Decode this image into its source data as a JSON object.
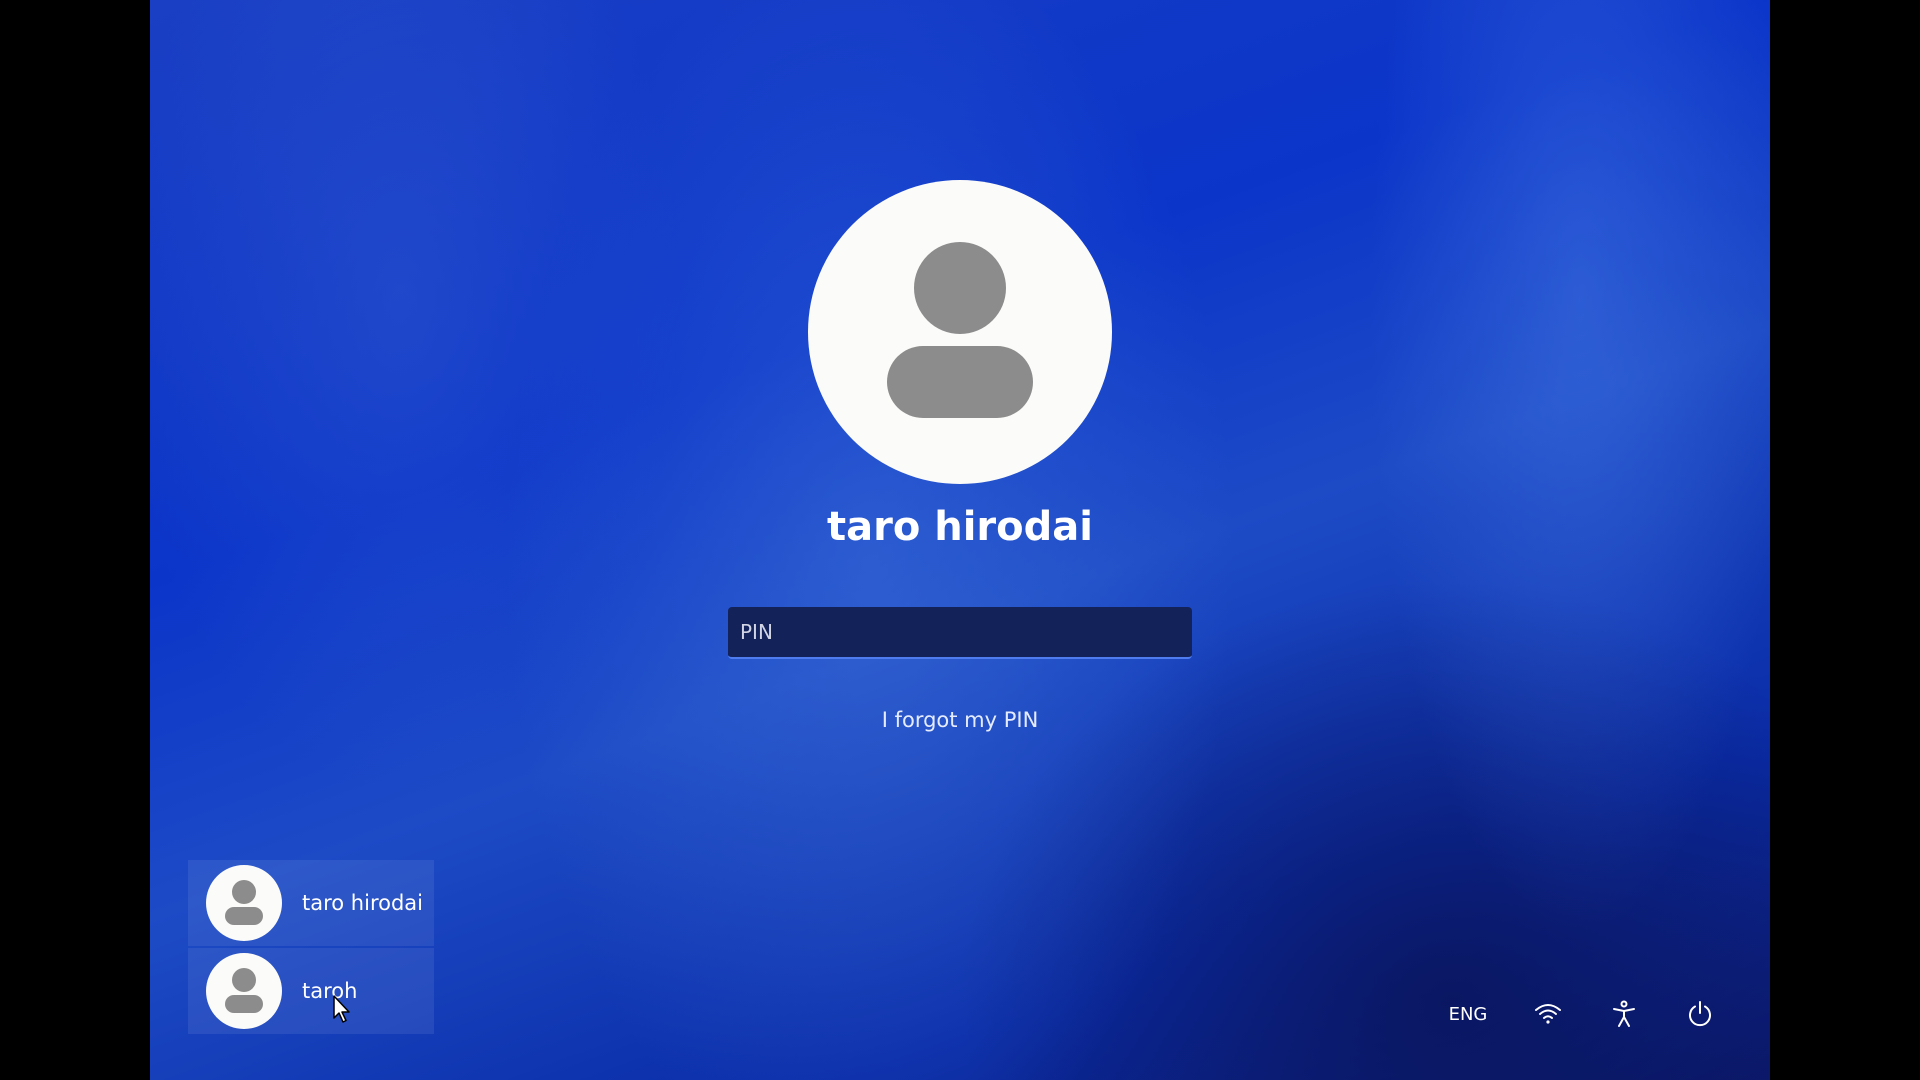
{
  "lock_screen": {
    "current_user": "taro hirodai",
    "pin_field": {
      "placeholder": "PIN",
      "value": ""
    },
    "forgot_pin_label": "I forgot my PIN"
  },
  "user_list": [
    {
      "name": "taro hirodai"
    },
    {
      "name": "taroh"
    }
  ],
  "system_tray": {
    "language": "ENG",
    "icons": [
      "wifi-icon",
      "accessibility-icon",
      "power-icon"
    ]
  },
  "colors": {
    "background_blue": "#0b35c9",
    "avatar_fill": "#fbfbf9",
    "avatar_silhouette": "#8c8c8c",
    "input_background": "#132359",
    "input_focus_border": "#4f7df0"
  }
}
